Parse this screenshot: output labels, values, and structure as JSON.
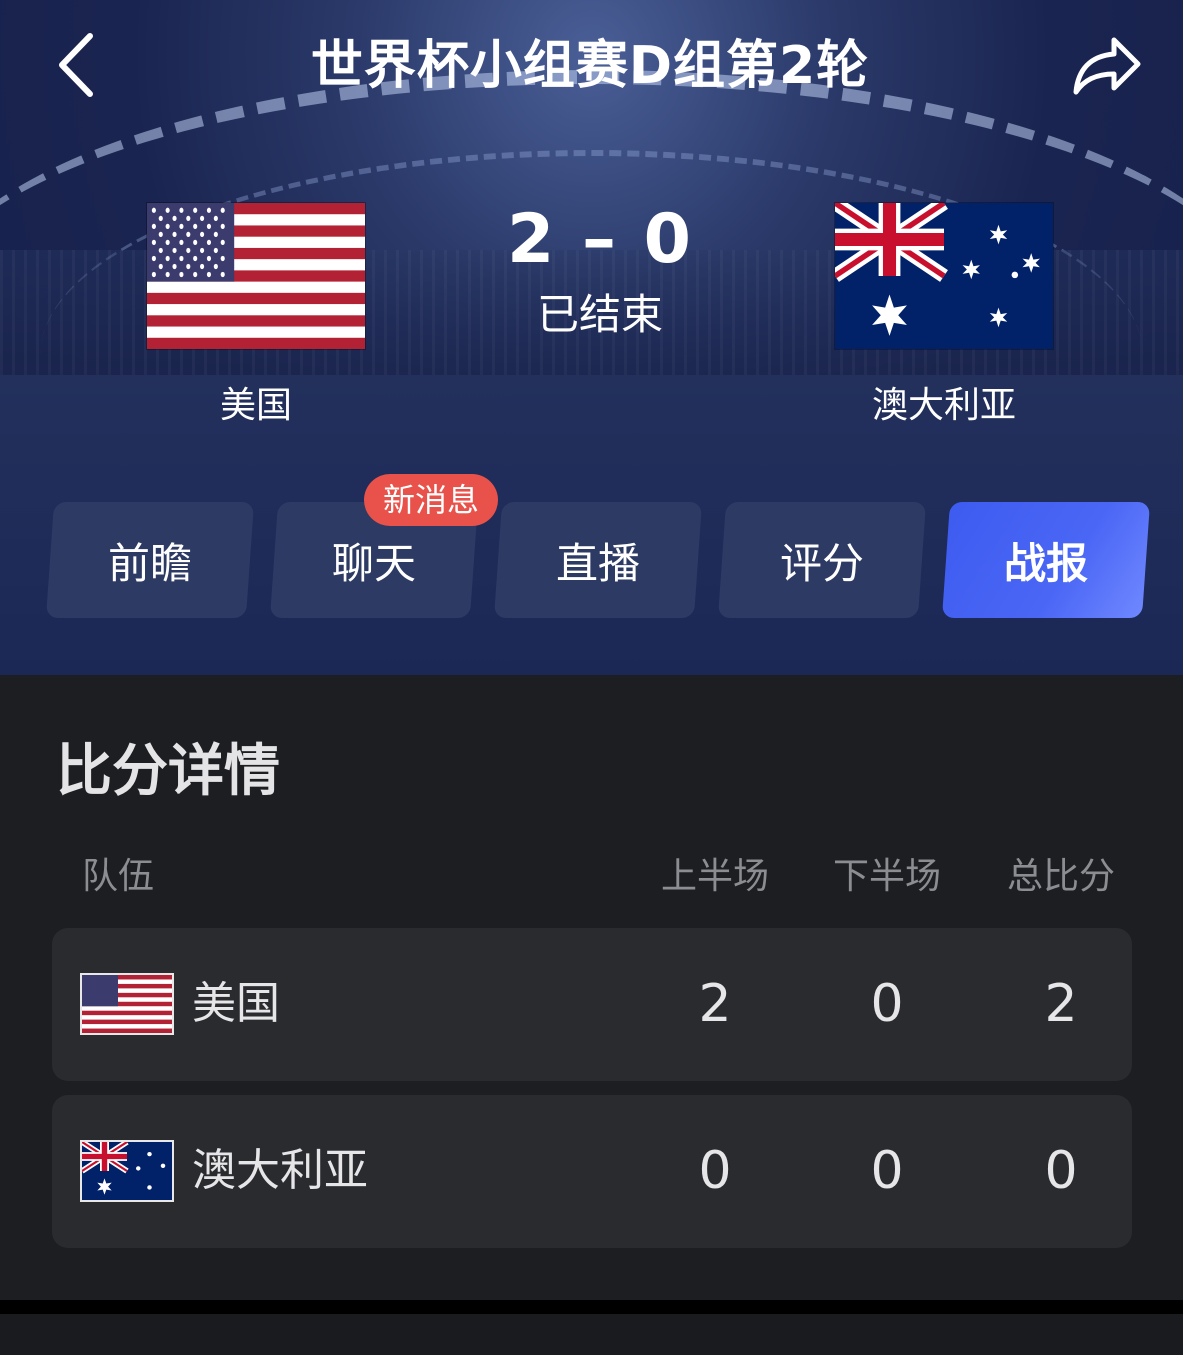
{
  "header": {
    "title": "世界杯小组赛D组第2轮"
  },
  "match": {
    "home": {
      "name": "美国"
    },
    "away": {
      "name": "澳大利亚"
    },
    "score": "2 – 0",
    "status": "已结束"
  },
  "tabs": [
    {
      "label": "前瞻",
      "active": false
    },
    {
      "label": "聊天",
      "active": false,
      "badge": "新消息"
    },
    {
      "label": "直播",
      "active": false
    },
    {
      "label": "评分",
      "active": false
    },
    {
      "label": "战报",
      "active": true
    }
  ],
  "details": {
    "title": "比分详情",
    "columns": [
      "队伍",
      "上半场",
      "下半场",
      "总比分"
    ],
    "rows": [
      {
        "team": "美国",
        "first_half": "2",
        "second_half": "0",
        "total": "2"
      },
      {
        "team": "澳大利亚",
        "first_half": "0",
        "second_half": "0",
        "total": "0"
      }
    ]
  },
  "colors": {
    "accent": "#4a66f5",
    "badge": "#e9524a",
    "tab_bg": "#2d3a63",
    "panel_bg": "#1d1e21",
    "row_bg": "#2a2b2f"
  }
}
